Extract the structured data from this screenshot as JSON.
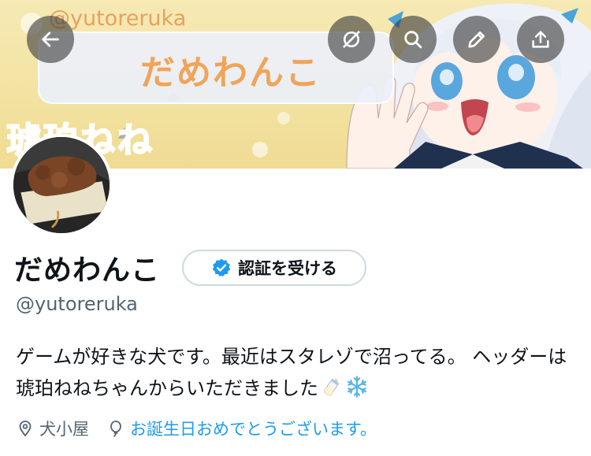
{
  "header": {
    "banner_handle": "@yutoreruka",
    "banner_name": "だめわんこ",
    "banner_subtitle": "琥珀ねね",
    "back_icon": "arrow-left-icon",
    "actions": [
      {
        "name": "hide-icon",
        "label": ""
      },
      {
        "name": "search-icon",
        "label": ""
      },
      {
        "name": "pencil-icon",
        "label": ""
      },
      {
        "name": "share-icon",
        "label": ""
      }
    ]
  },
  "profile": {
    "name": "だめわんこ",
    "verify_label": "認証を受ける",
    "handle": "@yutoreruka",
    "bio": "ゲームが好きな犬です。最近はスタレゾで沼ってる。 ヘッダーは琥珀ねねちゃんからいただきました",
    "bio_emojis": [
      "baby-bottle-icon",
      "snowflake-icon"
    ],
    "location": "犬小屋",
    "birthday_text": "お誕生日おめでとうございます。"
  },
  "colors": {
    "accent": "#1d9bf0",
    "secondary_text": "#536471",
    "primary_text": "#0f1419",
    "banner_yellow": "#f3e3a2",
    "button_overlay": "#3c3c3c"
  }
}
